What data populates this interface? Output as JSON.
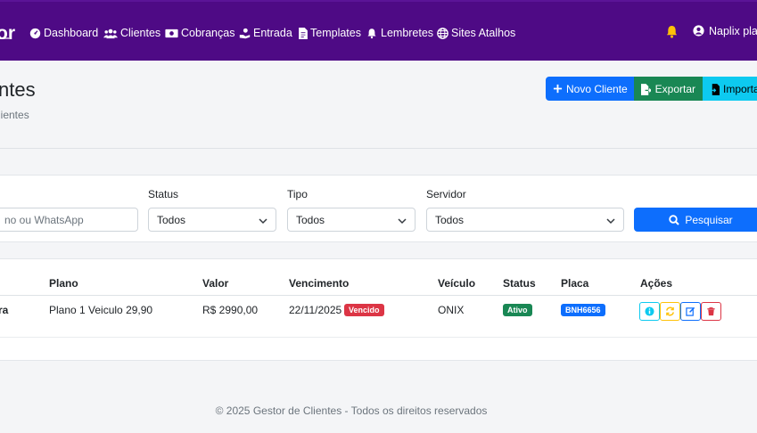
{
  "brand": {
    "text": "or"
  },
  "nav": {
    "items": [
      {
        "label": "Dashboard",
        "icon": "gauge-icon"
      },
      {
        "label": "Clientes",
        "icon": "users-icon"
      },
      {
        "label": "Cobranças",
        "icon": "money-icon"
      },
      {
        "label": "Entrada",
        "icon": "hand-money-icon"
      },
      {
        "label": "Templates",
        "icon": "file-icon"
      },
      {
        "label": "Lembretes",
        "icon": "bell-icon"
      },
      {
        "label": "Sites Atalhos",
        "icon": "globe-icon"
      }
    ],
    "user_label": "Naplix play"
  },
  "header": {
    "title": "ntes",
    "subtitle": "lientes",
    "buttons": {
      "new_client": "Novo Cliente",
      "export": "Exportar",
      "import": "Importar"
    }
  },
  "filters": {
    "search_placeholder": "no ou WhatsApp",
    "status_label": "Status",
    "status_value": "Todos",
    "tipo_label": "Tipo",
    "tipo_value": "Todos",
    "servidor_label": "Servidor",
    "servidor_value": "Todos",
    "search_button": "Pesquisar"
  },
  "table": {
    "headers": [
      "Plano",
      "Valor",
      "Vencimento",
      "Veículo",
      "Status",
      "Placa",
      "Ações"
    ],
    "rows": [
      {
        "name_fragment": "ra",
        "plano": "Plano 1 Veiculo 29,90",
        "valor": "R$ 2990,00",
        "vencimento": "22/11/2025",
        "vencido_badge": "Vencido",
        "veiculo": "ONIX",
        "status": "Ativo",
        "placa": "BNH6656"
      }
    ]
  },
  "colors": {
    "nav_bg": "#4e0a85",
    "primary": "#0d6efd",
    "success": "#198754",
    "info": "#0dcaf0",
    "danger": "#dc3545",
    "warning": "#ffc107"
  },
  "footer": {
    "text": "© 2025 Gestor de Clientes - Todos os direitos reservados"
  }
}
